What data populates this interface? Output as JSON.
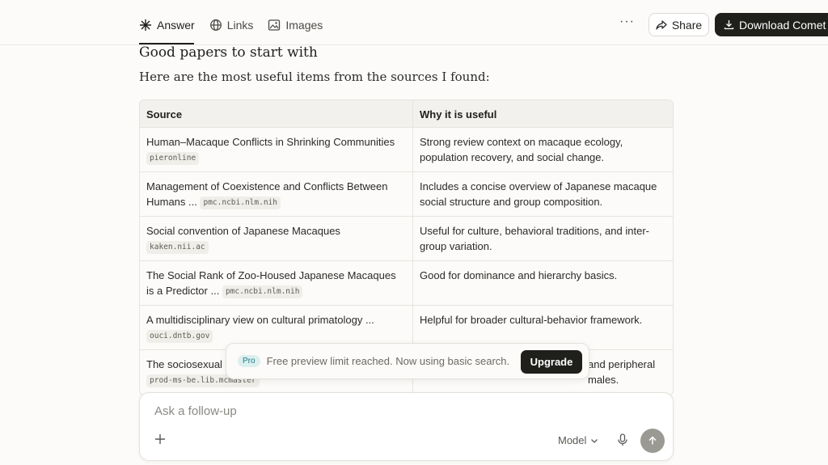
{
  "nav": {
    "tabs": [
      {
        "label": "Answer",
        "icon": "sparkle-icon"
      },
      {
        "label": "Links",
        "icon": "globe-icon"
      },
      {
        "label": "Images",
        "icon": "image-icon"
      }
    ],
    "more_label": "···",
    "share_label": "Share",
    "download_label": "Download Comet"
  },
  "content": {
    "heading": "Good papers to start with",
    "intro": "Here are the most useful items from the sources I found:"
  },
  "table": {
    "headers": [
      "Source",
      "Why it is useful"
    ],
    "rows": [
      {
        "source": "Human–Macaque Conflicts in Shrinking Communities",
        "cite": "pieronline",
        "why": "Strong review context on macaque ecology, population recovery, and social change."
      },
      {
        "source": "Management of Coexistence and Conflicts Between Humans ...",
        "cite": "pmc.ncbi.nlm.nih",
        "why": "Includes a concise overview of Japanese macaque social structure and group composition."
      },
      {
        "source": "Social convention of Japanese Macaques",
        "cite": "kaken.nii.ac",
        "why": "Useful for culture, behavioral traditions, and inter-group variation."
      },
      {
        "source": "The Social Rank of Zoo-Housed Japanese Macaques is a Predictor ...",
        "cite": "pmc.ncbi.nlm.nih",
        "why": "Good for dominance and hierarchy basics."
      },
      {
        "source": "A multidisciplinary view on cultural primatology ...",
        "cite": "ouci.dntb.gov",
        "why": "Helpful for broader cultural-behavior framework."
      },
      {
        "source": "The sociosexual",
        "cite": "prod-ms-be.lib.mcmaster",
        "why": "and peripheral males."
      }
    ]
  },
  "toast": {
    "badge": "Pro",
    "text": "Free preview limit reached. Now using basic search.",
    "button": "Upgrade"
  },
  "followup": {
    "placeholder": "Ask a follow-up",
    "model_label": "Model"
  }
}
